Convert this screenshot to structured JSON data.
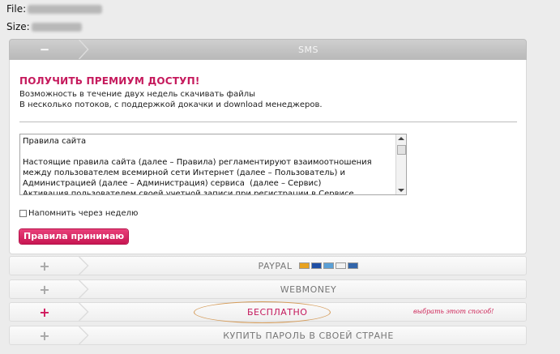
{
  "file": {
    "label": "File:"
  },
  "size": {
    "label": "Size:"
  },
  "sms": {
    "toggle": "−",
    "title": "SMS"
  },
  "premium": {
    "title": "ПОЛУЧИТЬ ПРЕМИУМ ДОСТУП!",
    "desc_line1": "Возможность в течение двух недель скачивать файлы",
    "desc_line2": "В несколько потоков, с поддержкой докачки и download менеджеров."
  },
  "rules": {
    "text": "Правила сайта\n\nНастоящие правила сайта (далее – Правила) регламентируют взаимоотношения между пользователем всемирной сети Интернет (далее – Пользователь) и Администрацией (далее – Администрация) сервиса  (далее – Сервис)\nАктивация пользователем своей учетной записи при регистрации в Сервисе, загрузка"
  },
  "remind": {
    "label": "Напомнить через неделю"
  },
  "accept_button": "Правила принимаю",
  "payment_options": {
    "paypal": {
      "toggle": "+",
      "title": "PAYPAL"
    },
    "webmoney": {
      "toggle": "+",
      "title": "WEBMONEY"
    },
    "free": {
      "toggle": "+",
      "title": "БЕСПЛАТНО",
      "note": "выбрать этот способ!"
    },
    "country": {
      "toggle": "+",
      "title": "КУПИТЬ ПАРОЛЬ В СВОЕЙ СТРАНЕ"
    }
  },
  "card_logos": [
    {
      "name": "mastercard-icon",
      "color": "#e8a21f"
    },
    {
      "name": "visa-icon",
      "color": "#1f4fa5"
    },
    {
      "name": "amex-icon",
      "color": "#5aa0d6"
    },
    {
      "name": "discover-icon",
      "color": "#f2f2f2"
    },
    {
      "name": "bank-card-icon",
      "color": "#3366aa"
    }
  ],
  "colors": {
    "accent": "#c5195c",
    "button": "#d4205e",
    "header_bar": "#c3c3c3",
    "highlight_ellipse": "#d59c5a"
  }
}
